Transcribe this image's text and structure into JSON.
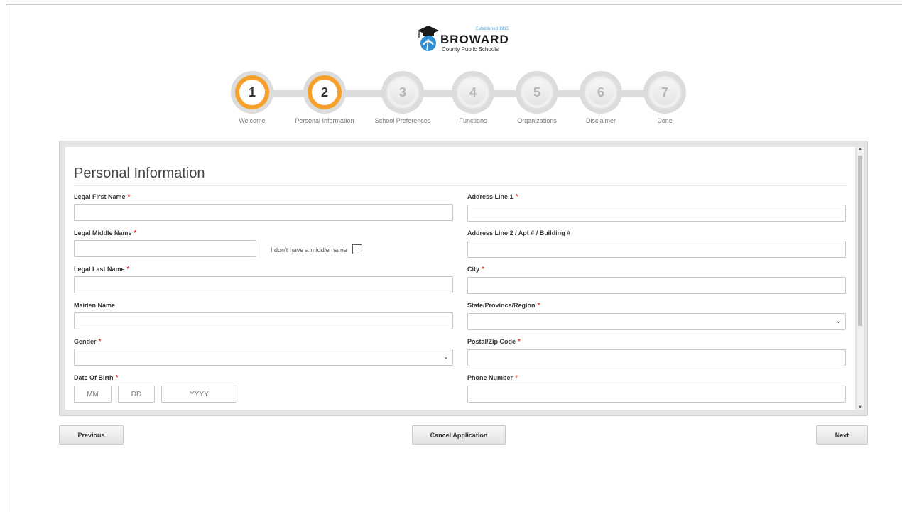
{
  "logo": {
    "established": "Established 1915",
    "name": "BROWARD",
    "subtitle": "County Public Schools"
  },
  "steps": [
    {
      "number": "1",
      "label": "Welcome",
      "state": "done"
    },
    {
      "number": "2",
      "label": "Personal Information",
      "state": "active"
    },
    {
      "number": "3",
      "label": "School Preferences",
      "state": "pending"
    },
    {
      "number": "4",
      "label": "Functions",
      "state": "pending"
    },
    {
      "number": "5",
      "label": "Organizations",
      "state": "pending"
    },
    {
      "number": "6",
      "label": "Disclaimer",
      "state": "pending"
    },
    {
      "number": "7",
      "label": "Done",
      "state": "pending"
    }
  ],
  "form": {
    "title": "Personal Information",
    "required_marker": "*",
    "fields": {
      "first_name": {
        "label": "Legal First Name",
        "value": ""
      },
      "middle_name": {
        "label": "Legal Middle Name",
        "value": ""
      },
      "no_middle_name": {
        "label": "I don't have a middle name",
        "checked": false
      },
      "last_name": {
        "label": "Legal Last Name",
        "value": ""
      },
      "maiden_name": {
        "label": "Maiden Name",
        "value": ""
      },
      "gender": {
        "label": "Gender",
        "value": ""
      },
      "dob": {
        "label": "Date Of Birth",
        "mm_placeholder": "MM",
        "dd_placeholder": "DD",
        "yyyy_placeholder": "YYYY"
      },
      "address1": {
        "label": "Address Line 1",
        "value": ""
      },
      "address2": {
        "label": "Address Line 2 / Apt # / Building #",
        "value": ""
      },
      "city": {
        "label": "City",
        "value": ""
      },
      "state": {
        "label": "State/Province/Region",
        "value": ""
      },
      "postal": {
        "label": "Postal/Zip Code",
        "value": ""
      },
      "phone": {
        "label": "Phone Number",
        "value": ""
      }
    }
  },
  "buttons": {
    "previous": "Previous",
    "cancel": "Cancel Application",
    "next": "Next"
  },
  "colors": {
    "accent": "#f5a12b",
    "required": "#e04040"
  }
}
